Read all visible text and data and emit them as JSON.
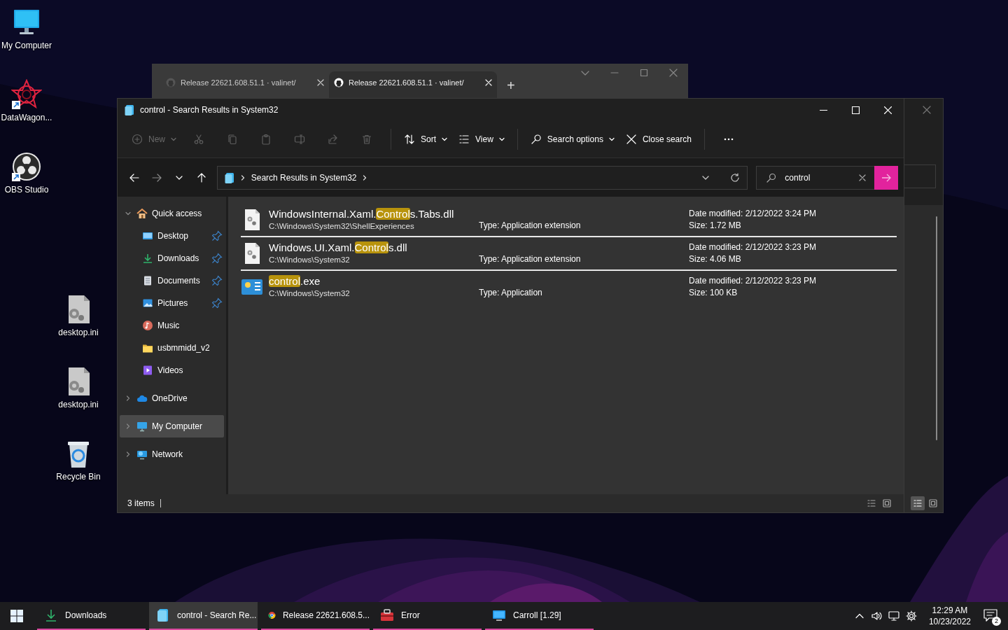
{
  "desktop_icon_columns": [
    [
      {
        "label": "My Computer",
        "kind": "monitor",
        "shortcut": false
      },
      {
        "label": "DataWagon...",
        "kind": "star",
        "shortcut": true
      },
      {
        "label": "OBS Studio",
        "kind": "obs",
        "shortcut": true
      }
    ],
    [
      {
        "label": "desktop.ini",
        "kind": "settings_file",
        "shortcut": false
      },
      {
        "label": "desktop.ini",
        "kind": "settings_file",
        "shortcut": false
      },
      {
        "label": "Recycle Bin",
        "kind": "recycle_bin",
        "shortcut": false
      }
    ]
  ],
  "browser_window": {
    "tabs": [
      {
        "title": "Release 22621.608.51.1 · valinet/",
        "selected": false
      },
      {
        "title": "Release 22621.608.51.1 · valinet/",
        "selected": true
      }
    ],
    "new_tab": "+"
  },
  "behind_window": {
    "view_buttons": [
      {
        "kind": "details",
        "selected": true
      },
      {
        "kind": "tiles",
        "selected": false
      }
    ]
  },
  "explorer": {
    "title": "control - Search Results in System32",
    "toolbar": [
      {
        "kind": "new",
        "label": "New",
        "disabled": true,
        "dropdown": true
      },
      {
        "kind": "cut",
        "disabled": true
      },
      {
        "kind": "copy",
        "disabled": true
      },
      {
        "kind": "paste",
        "disabled": true
      },
      {
        "kind": "rename",
        "disabled": true
      },
      {
        "kind": "share",
        "disabled": true
      },
      {
        "kind": "delete",
        "disabled": true
      },
      {
        "kind": "separator"
      },
      {
        "kind": "sort",
        "label": "Sort",
        "disabled": false,
        "dropdown": true
      },
      {
        "kind": "view",
        "label": "View",
        "disabled": false,
        "dropdown": true
      },
      {
        "kind": "separator"
      },
      {
        "kind": "search_options",
        "label": "Search options",
        "disabled": false,
        "dropdown": true
      },
      {
        "kind": "close_search",
        "label": "Close search",
        "disabled": false,
        "dropdown": false
      },
      {
        "kind": "separator"
      },
      {
        "kind": "more",
        "disabled": false
      }
    ],
    "navigation": [
      {
        "kind": "back",
        "disabled": false
      },
      {
        "kind": "forward",
        "disabled": true
      },
      {
        "kind": "recent",
        "disabled": false
      },
      {
        "kind": "up",
        "disabled": false
      }
    ],
    "breadcrumbs": [
      "Search Results in System32"
    ],
    "search": {
      "value": "control"
    },
    "sidebar": [
      {
        "label": "Quick access",
        "kind": "home",
        "selected": false,
        "expanded": true,
        "children": [
          {
            "label": "Desktop",
            "kind": "desktop",
            "selected": false,
            "pinned": true
          },
          {
            "label": "Downloads",
            "kind": "download",
            "selected": false,
            "pinned": true
          },
          {
            "label": "Documents",
            "kind": "documents",
            "selected": false,
            "pinned": true
          },
          {
            "label": "Pictures",
            "kind": "pictures",
            "selected": false,
            "pinned": true
          },
          {
            "label": "Music",
            "kind": "music",
            "selected": false,
            "pinned": false
          },
          {
            "label": "usbmmidd_v2",
            "kind": "folder",
            "selected": false,
            "pinned": false
          },
          {
            "label": "Videos",
            "kind": "videos",
            "selected": false,
            "pinned": false
          }
        ]
      },
      {
        "label": "OneDrive",
        "kind": "cloud",
        "selected": false,
        "expanded": false
      },
      {
        "label": "My Computer",
        "kind": "computer",
        "selected": true,
        "expanded": false
      },
      {
        "label": "Network",
        "kind": "network",
        "selected": false,
        "expanded": false
      }
    ],
    "results": [
      {
        "kind": "dll",
        "name_parts": [
          {
            "text": "WindowsInternal.Xaml.",
            "match": false
          },
          {
            "text": "Control",
            "match": true
          },
          {
            "text": "s.Tabs.dll",
            "match": false
          }
        ],
        "path": "C:\\Windows\\System32\\ShellExperiences",
        "type": "Type: Application extension",
        "date": "Date modified: 2/12/2022 3:24 PM",
        "size": "Size: 1.72 MB"
      },
      {
        "kind": "dll",
        "name_parts": [
          {
            "text": "Windows.UI.Xaml.",
            "match": false
          },
          {
            "text": "Control",
            "match": true
          },
          {
            "text": "s.dll",
            "match": false
          }
        ],
        "path": "C:\\Windows\\System32",
        "type": "Type: Application extension",
        "date": "Date modified: 2/12/2022 3:23 PM",
        "size": "Size: 4.06 MB"
      },
      {
        "kind": "exe",
        "name_parts": [
          {
            "text": "control",
            "match": true
          },
          {
            "text": ".exe",
            "match": false
          }
        ],
        "path": "C:\\Windows\\System32",
        "type": "Type: Application",
        "date": "Date modified: 2/12/2022 3:23 PM",
        "size": "Size: 100 KB"
      }
    ],
    "status": {
      "count": "3 items",
      "view_buttons": [
        {
          "kind": "details",
          "selected": false
        },
        {
          "kind": "tiles",
          "selected": false
        }
      ]
    }
  },
  "taskbar": {
    "items": [
      {
        "label": "Downloads",
        "kind": "download",
        "selected": false,
        "running": true
      },
      {
        "label": "control - Search Re...",
        "kind": "explorer",
        "selected": true,
        "running": true
      },
      {
        "label": "Release 22621.608.5...",
        "kind": "browser",
        "selected": false,
        "running": true
      },
      {
        "label": "Error",
        "kind": "toolbox",
        "selected": false,
        "running": true
      },
      {
        "label": "Carroll [1.29]",
        "kind": "display",
        "selected": false,
        "running": true
      }
    ],
    "time": "12:29 AM",
    "date": "10/23/2022",
    "notification_count": "2"
  }
}
